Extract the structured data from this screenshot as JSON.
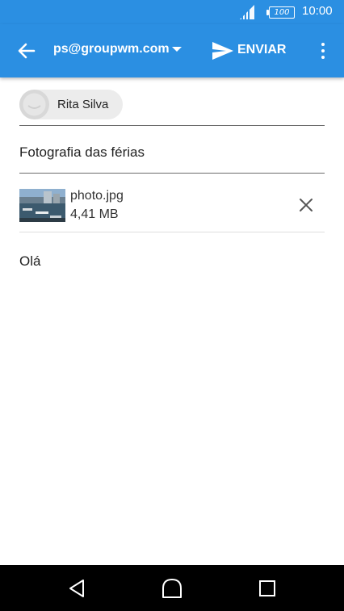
{
  "status_bar": {
    "battery": "100",
    "time": "10:00"
  },
  "app_bar": {
    "back_icon": "arrow-left-icon",
    "account": "ps@groupwm.com",
    "send_label": "ENVIAR",
    "send_icon": "send-icon",
    "more_icon": "more-vert-icon"
  },
  "compose": {
    "recipient": "Rita Silva",
    "subject": "Fotografia das férias",
    "attachment": {
      "name": "photo.jpg",
      "size": "4,41 MB"
    },
    "body": "Olá"
  },
  "colors": {
    "accent": "#2b8fe2",
    "chip": "#ececec",
    "nav": "#000000"
  }
}
